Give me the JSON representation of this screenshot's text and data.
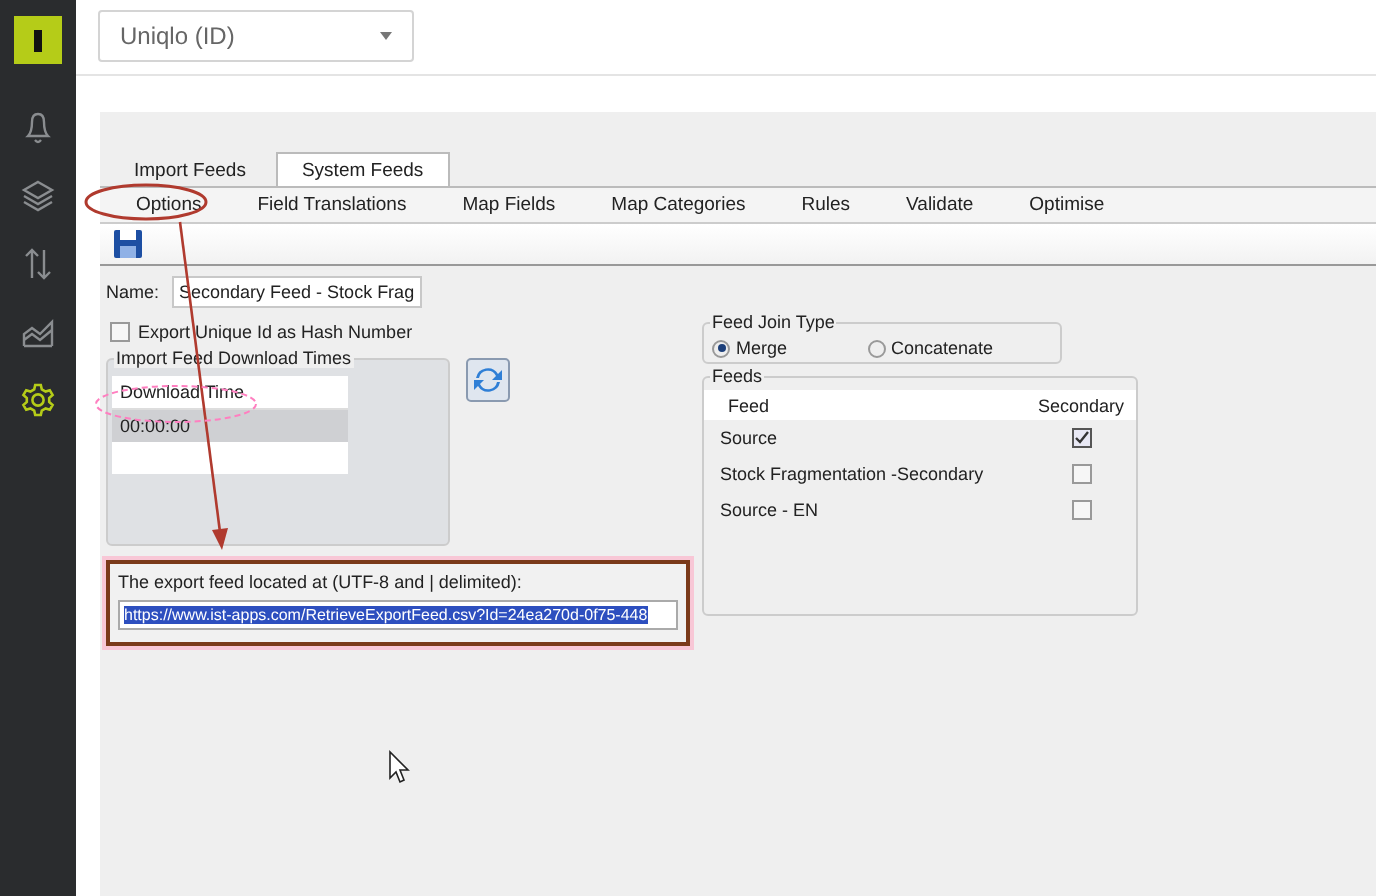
{
  "account_select": {
    "value": "Uniqlo (ID)"
  },
  "sidebar": {
    "items": [
      {
        "kind": "bell",
        "selected": false
      },
      {
        "kind": "layers",
        "selected": false
      },
      {
        "kind": "transfer",
        "selected": false
      },
      {
        "kind": "chart",
        "selected": false
      },
      {
        "kind": "gear",
        "selected": true
      }
    ]
  },
  "tabs": [
    {
      "label": "Import Feeds",
      "selected": false
    },
    {
      "label": "System Feeds",
      "selected": true
    }
  ],
  "subtabs": [
    {
      "label": "Options"
    },
    {
      "label": "Field Translations"
    },
    {
      "label": "Map Fields"
    },
    {
      "label": "Map Categories"
    },
    {
      "label": "Rules"
    },
    {
      "label": "Validate"
    },
    {
      "label": "Optimise"
    }
  ],
  "name_field": {
    "label": "Name:",
    "value": "Secondary Feed - Stock Frag"
  },
  "export_hash": {
    "label": "Export Unique Id as Hash Number",
    "checked": false
  },
  "download_times": {
    "title": "Import Feed Download Times",
    "column": "Download Time",
    "rows": [
      {
        "time": "00:00:00",
        "selected": true
      }
    ]
  },
  "export": {
    "label": "The export feed located at (UTF-8 and | delimited):",
    "url": "https://www.ist-apps.com/RetrieveExportFeed.csv?Id=24ea270d-0f75-448",
    "selected": true
  },
  "join_type": {
    "title": "Feed Join Type",
    "options": [
      {
        "label": "Merge",
        "selected": true
      },
      {
        "label": "Concatenate",
        "selected": false
      }
    ]
  },
  "feeds": {
    "title": "Feeds",
    "columns": [
      "Feed",
      "Secondary"
    ],
    "rows": [
      {
        "name": "Source",
        "secondary": true
      },
      {
        "name": "Stock Fragmentation -Secondary",
        "secondary": false
      },
      {
        "name": "Source - EN",
        "secondary": false
      }
    ]
  }
}
